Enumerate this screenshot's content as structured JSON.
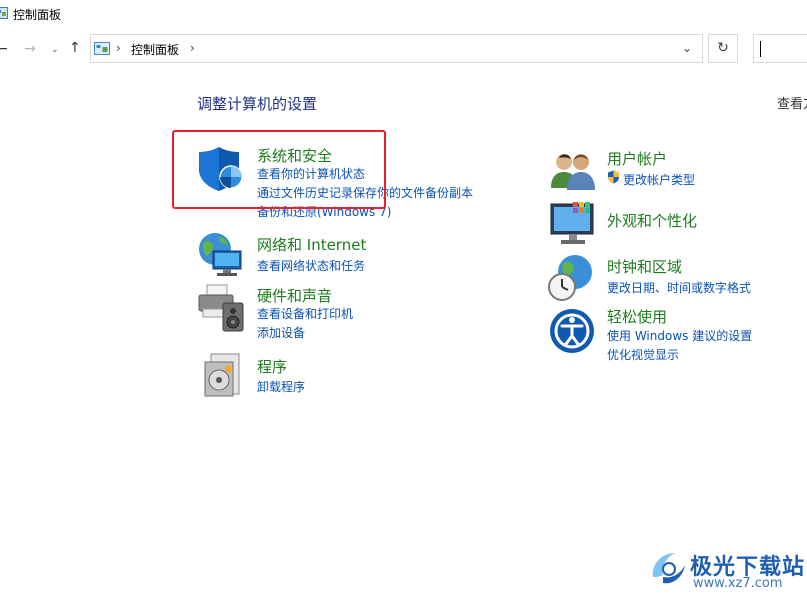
{
  "window": {
    "title": "控制面板"
  },
  "nav": {
    "back_glyph": "←",
    "forward_glyph": "→",
    "recent_glyph": "⌄",
    "up_glyph": "↑",
    "separator": "›",
    "breadcrumb": "控制面板",
    "dropdown_glyph": "⌄",
    "refresh_glyph": "↻"
  },
  "main": {
    "heading": "调整计算机的设置",
    "view_by": "查看方"
  },
  "categories_left": [
    {
      "title": "系统和安全",
      "links": [
        "查看你的计算机状态",
        "通过文件历史记录保存你的文件备份副本",
        "备份和还原(Windows 7)"
      ]
    },
    {
      "title": "网络和 Internet",
      "links": [
        "查看网络状态和任务"
      ]
    },
    {
      "title": "硬件和声音",
      "links": [
        "查看设备和打印机",
        "添加设备"
      ]
    },
    {
      "title": "程序",
      "links": [
        "卸载程序"
      ]
    }
  ],
  "categories_right": [
    {
      "title": "用户帐户",
      "links": [
        "更改帐户类型"
      ]
    },
    {
      "title": "外观和个性化",
      "links": []
    },
    {
      "title": "时钟和区域",
      "links": [
        "更改日期、时间或数字格式"
      ]
    },
    {
      "title": "轻松使用",
      "links": [
        "使用 Windows 建议的设置",
        "优化视觉显示"
      ]
    }
  ],
  "watermark": {
    "brand": "极光下载站",
    "url": "www.xz7.com"
  },
  "colors": {
    "heading": "#1e3287",
    "category": "#1e7b1e",
    "link": "#0a52b5",
    "highlight": "#e8202a"
  }
}
